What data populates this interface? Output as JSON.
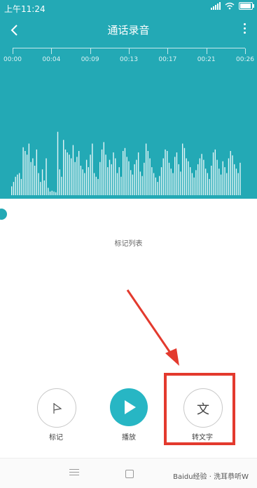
{
  "status_bar": {
    "time": "上午11:24"
  },
  "header": {
    "title": "通话录音"
  },
  "timeline": {
    "ticks": [
      "00:00",
      "00:04",
      "00:09",
      "00:13",
      "00:17",
      "00:21",
      "00:26"
    ]
  },
  "waveform": {
    "amplitudes": [
      0.12,
      0.18,
      0.25,
      0.28,
      0.3,
      0.22,
      0.65,
      0.6,
      0.55,
      0.7,
      0.45,
      0.5,
      0.4,
      0.62,
      0.3,
      0.18,
      0.35,
      0.2,
      0.5,
      0.1,
      0.05,
      0.06,
      0.05,
      0.04,
      0.86,
      0.35,
      0.25,
      0.75,
      0.62,
      0.58,
      0.55,
      0.5,
      0.68,
      0.45,
      0.52,
      0.6,
      0.4,
      0.35,
      0.3,
      0.48,
      0.38,
      0.55,
      0.7,
      0.3,
      0.25,
      0.22,
      0.45,
      0.62,
      0.72,
      0.55,
      0.38,
      0.48,
      0.42,
      0.58,
      0.5,
      0.3,
      0.38,
      0.25,
      0.6,
      0.64,
      0.52,
      0.46,
      0.34,
      0.28,
      0.42,
      0.48,
      0.58,
      0.32,
      0.26,
      0.44,
      0.7,
      0.6,
      0.5,
      0.38,
      0.3,
      0.24,
      0.18,
      0.26,
      0.38,
      0.5,
      0.62,
      0.6,
      0.44,
      0.36,
      0.3,
      0.52,
      0.58,
      0.42,
      0.32,
      0.7,
      0.64,
      0.5,
      0.46,
      0.38,
      0.3,
      0.24,
      0.34,
      0.42,
      0.5,
      0.56,
      0.48,
      0.36,
      0.3,
      0.22,
      0.4,
      0.58,
      0.62,
      0.48,
      0.36,
      0.28,
      0.46,
      0.38,
      0.3,
      0.5,
      0.6,
      0.54,
      0.42,
      0.36,
      0.3,
      0.44
    ]
  },
  "marks_list": {
    "label": "标记列表"
  },
  "controls": {
    "mark_label": "标记",
    "play_label": "播放",
    "transcribe_label": "转文字",
    "transcribe_glyph": "文"
  },
  "watermark": {
    "text": "Baidu经验 · 洗耳恭听W"
  },
  "colors": {
    "accent": "#23a9b5",
    "play": "#27b6c4",
    "highlight": "#e33a2e"
  }
}
